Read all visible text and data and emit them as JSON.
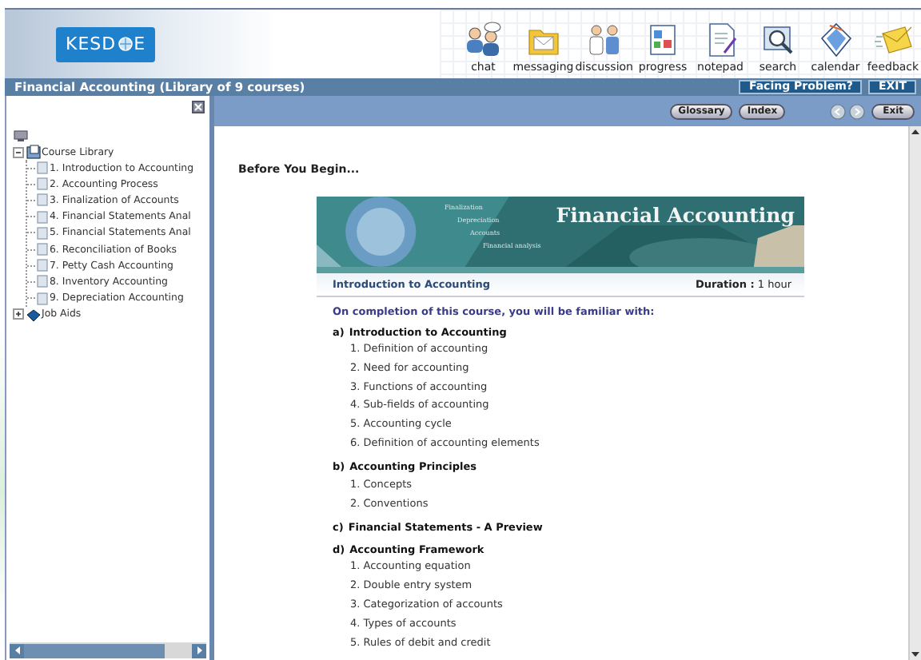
{
  "header": {
    "logo": {
      "before": "KESD",
      "after": "E"
    },
    "tools": [
      {
        "label": "chat"
      },
      {
        "label": "messaging"
      },
      {
        "label": "discussion"
      },
      {
        "label": "progress"
      },
      {
        "label": "notepad"
      },
      {
        "label": "search"
      },
      {
        "label": "calendar"
      },
      {
        "label": "feedback"
      }
    ]
  },
  "title_bar": {
    "title": "Financial Accounting (Library of 9 courses)",
    "buttons": [
      "Facing Problem?",
      "EXIT"
    ]
  },
  "sidebar": {
    "tree": [
      {
        "label": "Course Library",
        "kind": "library",
        "expanded": true,
        "children": [
          {
            "label": "1. Introduction to Accounting"
          },
          {
            "label": "2. Accounting Process"
          },
          {
            "label": "3. Finalization of Accounts"
          },
          {
            "label": "4. Financial Statements Anal"
          },
          {
            "label": "5. Financial Statements Anal"
          },
          {
            "label": "6. Reconciliation of Books"
          },
          {
            "label": "7. Petty Cash Accounting"
          },
          {
            "label": "8. Inventory Accounting"
          },
          {
            "label": "9. Depreciation Accounting"
          }
        ]
      },
      {
        "label": "Job Aids",
        "kind": "book",
        "expanded": false
      }
    ]
  },
  "toolbar": {
    "buttons": [
      "Glossary",
      "Index"
    ],
    "exit": "Exit"
  },
  "content": {
    "heading": "Before You Begin...",
    "banner": {
      "title": "Financial Accounting",
      "words": [
        "Finalization",
        "Depreciation",
        "Accounts",
        "Financial analysis"
      ]
    },
    "course_title": "Introduction to Accounting",
    "duration": "**Duration :** 1 hour",
    "intro": "On completion of this course, you will be familiar with:",
    "sections": [
      {
        "label": "a)",
        "title": "Introduction to Accounting",
        "items": [
          "1. Definition of accounting",
          "2. Need for accounting",
          "3. Functions of accounting",
          "4. Sub-fields of accounting",
          "5. Accounting cycle",
          "6. Definition of accounting elements"
        ]
      },
      {
        "label": "b)",
        "title": "Accounting Principles",
        "items": [
          "1. Concepts",
          "2. Conventions"
        ]
      },
      {
        "label": "c)",
        "title": "Financial Statements - A Preview"
      },
      {
        "label": "d)",
        "title": "Accounting Framework",
        "items": [
          "1. Accounting equation",
          "2. Double entry system",
          "3. Categorization of accounts",
          "4. Types of accounts",
          "5. Rules of debit and credit"
        ]
      }
    ]
  }
}
